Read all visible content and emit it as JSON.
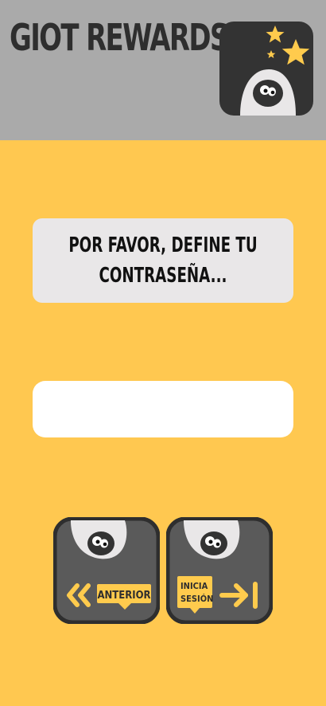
{
  "header": {
    "title": "GIOT REWARDS",
    "logo_icon": "giot-mascot-stars-logo"
  },
  "prompt": {
    "line1": "POR FAVOR, DEFINE TU",
    "line2": "CONTRASEÑA..."
  },
  "password": {
    "value": "",
    "placeholder": ""
  },
  "buttons": {
    "previous_label": "ANTERIOR",
    "login_label_line1": "INICIA",
    "login_label_line2": "SESIÓN"
  },
  "colors": {
    "background": "#FFC850",
    "header": "#AAAAAA",
    "accent": "#FFCB4D",
    "dark": "#2E2E2E"
  }
}
